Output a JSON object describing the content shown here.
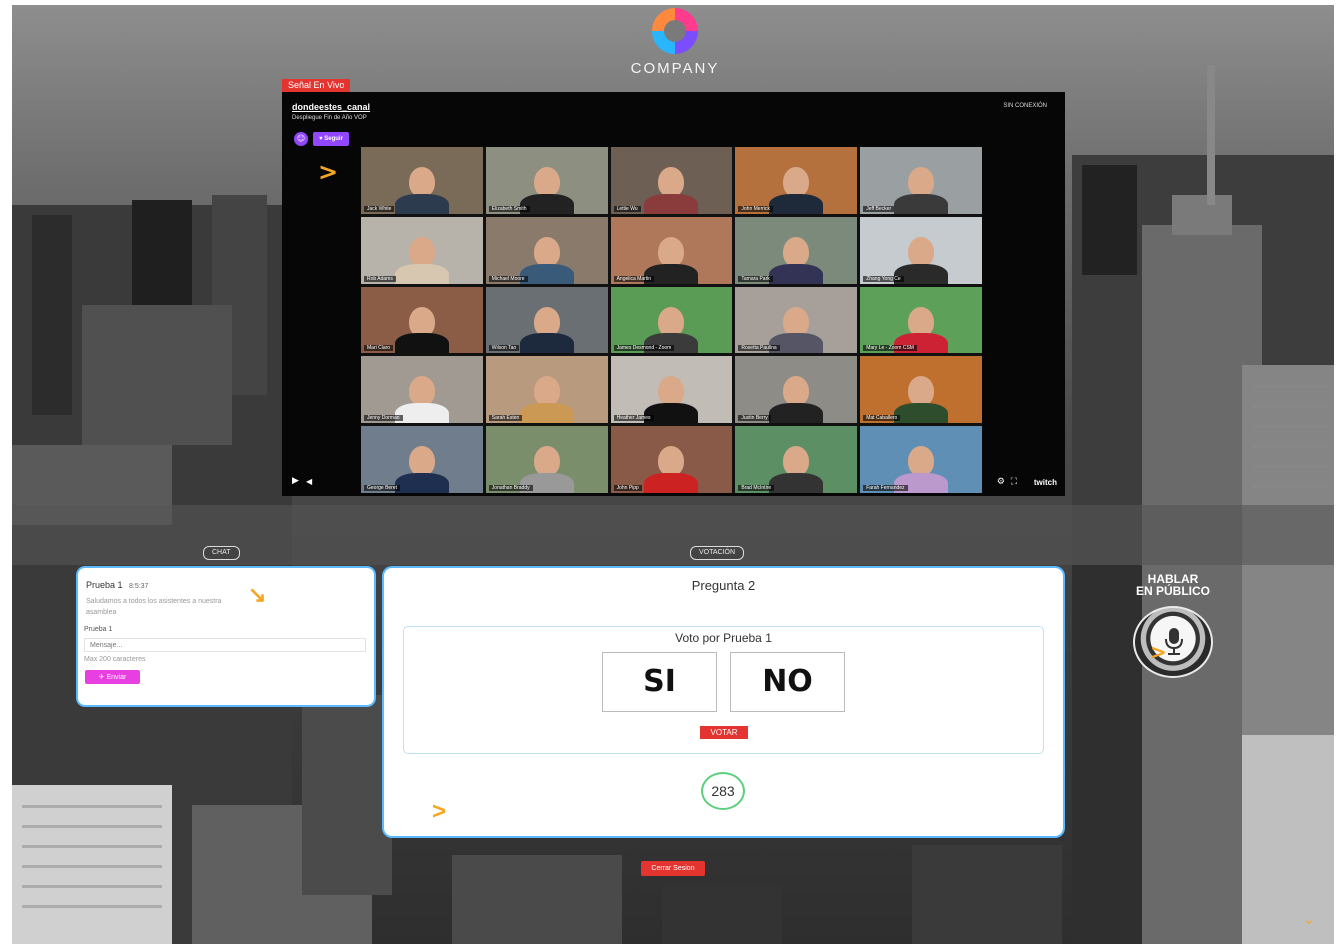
{
  "header": {
    "brand": "COMPANY"
  },
  "stream": {
    "live_badge": "Señal En Vivo",
    "channel": "dondeestes_canal",
    "description": "Despliegue Fin de Año VOP",
    "status": "SIN CONEXIÓN",
    "follow_label": "♥ Seguir",
    "brand": "twitch",
    "participants": [
      "Jack White",
      "Elizabeth Smith",
      "Lettie Wu",
      "John Merrick",
      "Jeff Becker",
      "Rob Adams",
      "Michael Moore",
      "Angelica Martin",
      "Tamara Park",
      "Zhang Yong Ce",
      "Mari Claro",
      "Wilson Tao",
      "James Desmond - Zoom",
      "Rosetta Paulina",
      "Mary Le - Zoom CSM",
      "Jenny Dorman",
      "Sarah Esten",
      "Heather James",
      "Justin Berry",
      "Mat Caballero",
      "George Beret",
      "Jonathan Braddy",
      "John Pipp",
      "Brad McIntire",
      "Farah Fernandez"
    ]
  },
  "labels": {
    "chat": "CHAT",
    "voting": "VOTACIÓN"
  },
  "chat": {
    "message_user": "Prueba 1",
    "message_time": "8:5:37",
    "message_text": "Saludamos a todos los asistentes a nuestra asamblea",
    "sender_name": "Prueba 1",
    "input_placeholder": "Mensaje...",
    "max_chars": "Max 200 caracteres",
    "send_label": "✈ Enviar"
  },
  "voting": {
    "question": "Pregunta 2",
    "heading": "Voto por Prueba 1",
    "option_yes": "SI",
    "option_no": "NO",
    "vote_label": "VOTAR",
    "count": "283"
  },
  "speak": {
    "title_line1": "HABLAR",
    "title_line2": "EN PÚBLICO"
  },
  "logout_label": "Cerrar Sesion"
}
